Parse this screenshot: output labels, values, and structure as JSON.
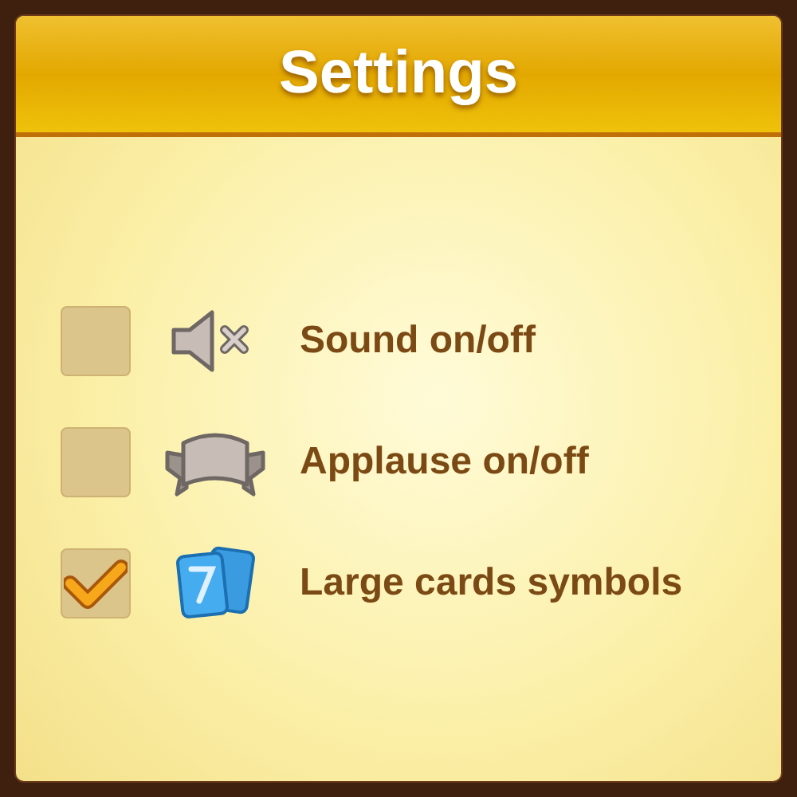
{
  "title": "Settings",
  "options": [
    {
      "label": "Sound on/off",
      "checked": false,
      "kind": "sound"
    },
    {
      "label": "Applause on/off",
      "checked": false,
      "kind": "applause"
    },
    {
      "label": "Large cards symbols",
      "checked": true,
      "kind": "cards"
    }
  ]
}
